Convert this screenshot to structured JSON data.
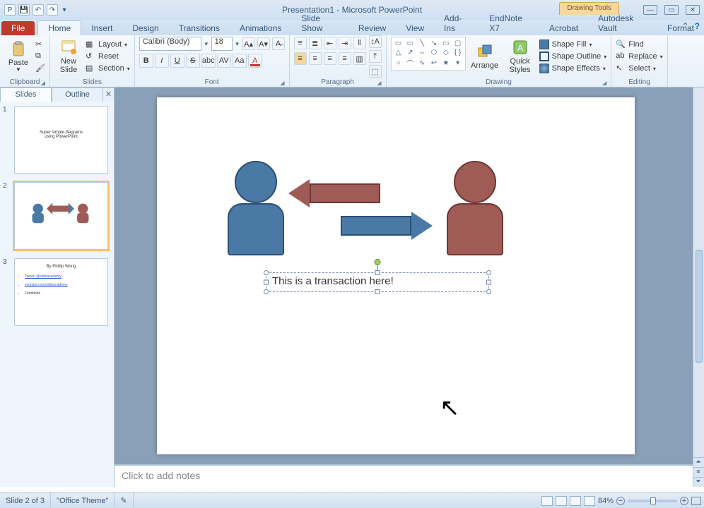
{
  "title": "Presentation1 - Microsoft PowerPoint",
  "context_tab": "Drawing Tools",
  "tabs": {
    "file": "File",
    "home": "Home",
    "insert": "Insert",
    "design": "Design",
    "transitions": "Transitions",
    "animations": "Animations",
    "slideshow": "Slide Show",
    "review": "Review",
    "view": "View",
    "addins": "Add-Ins",
    "endnote": "EndNote X7",
    "acrobat": "Acrobat",
    "vault": "Autodesk Vault",
    "format": "Format"
  },
  "groups": {
    "clipboard": {
      "label": "Clipboard",
      "paste": "Paste"
    },
    "slides": {
      "label": "Slides",
      "newslide": "New\nSlide",
      "layout": "Layout",
      "reset": "Reset",
      "section": "Section"
    },
    "font": {
      "label": "Font",
      "name": "Calibri (Body)",
      "size": "18"
    },
    "paragraph": {
      "label": "Paragraph"
    },
    "drawing": {
      "label": "Drawing",
      "arrange": "Arrange",
      "quick": "Quick\nStyles",
      "fill": "Shape Fill",
      "outline": "Shape Outline",
      "effects": "Shape Effects"
    },
    "editing": {
      "label": "Editing",
      "find": "Find",
      "replace": "Replace",
      "select": "Select"
    }
  },
  "panel": {
    "slides": "Slides",
    "outline": "Outline"
  },
  "thumbs": {
    "t1_line1": "Super simple diagrams",
    "t1_line2": "using PowerPoint",
    "t3_author": "By Phillip Wong",
    "t3_l1": "Tweet: @slideacademy",
    "t3_l2": "youtube.com/slideacademy",
    "t3_l3": "Facebook"
  },
  "slide": {
    "textbox": "This is a transaction here!"
  },
  "notes_placeholder": "Click to add notes",
  "status": {
    "slide": "Slide 2 of 3",
    "theme": "\"Office Theme\"",
    "zoom": "84%"
  }
}
